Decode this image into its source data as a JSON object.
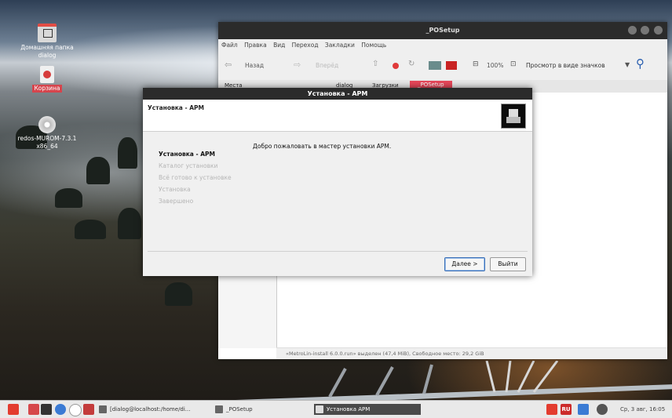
{
  "desktop": {
    "icons": [
      {
        "label": "Домашняя папка dialog"
      },
      {
        "label": "Корзина"
      },
      {
        "label": "redos-MUROM-7.3.1 x86_64"
      }
    ]
  },
  "file_manager": {
    "title": "_POSetup",
    "menu": [
      "Файл",
      "Правка",
      "Вид",
      "Переход",
      "Закладки",
      "Помощь"
    ],
    "back_label": "Назад",
    "forward_label": "Вперёд",
    "zoom": "100%",
    "view_mode": "Просмотр в виде значков",
    "sidebar_label": "Места",
    "path": [
      "dialog",
      "Загрузки",
      "_POSetup"
    ],
    "status": "«MetroLin-install 6.0.0.run» выделен (47,4 MiB), Свободное место: 29,2 GiB"
  },
  "installer": {
    "title": "Установка - АРМ",
    "header": "Установка - АРМ",
    "welcome": "Добро пожаловать в мастер установки АРМ.",
    "steps": [
      "Установка - АРМ",
      "Каталог установки",
      "Всё готово к установке",
      "Установка",
      "Завершено"
    ],
    "next_label": "Далее >",
    "exit_label": "Выйти"
  },
  "taskbar": {
    "tasks": [
      "[dialog@localhost:/home/di...",
      "_POSetup",
      "Установка АРМ"
    ],
    "lang": "RU",
    "clock": "Ср, 3 авг, 16:05"
  }
}
